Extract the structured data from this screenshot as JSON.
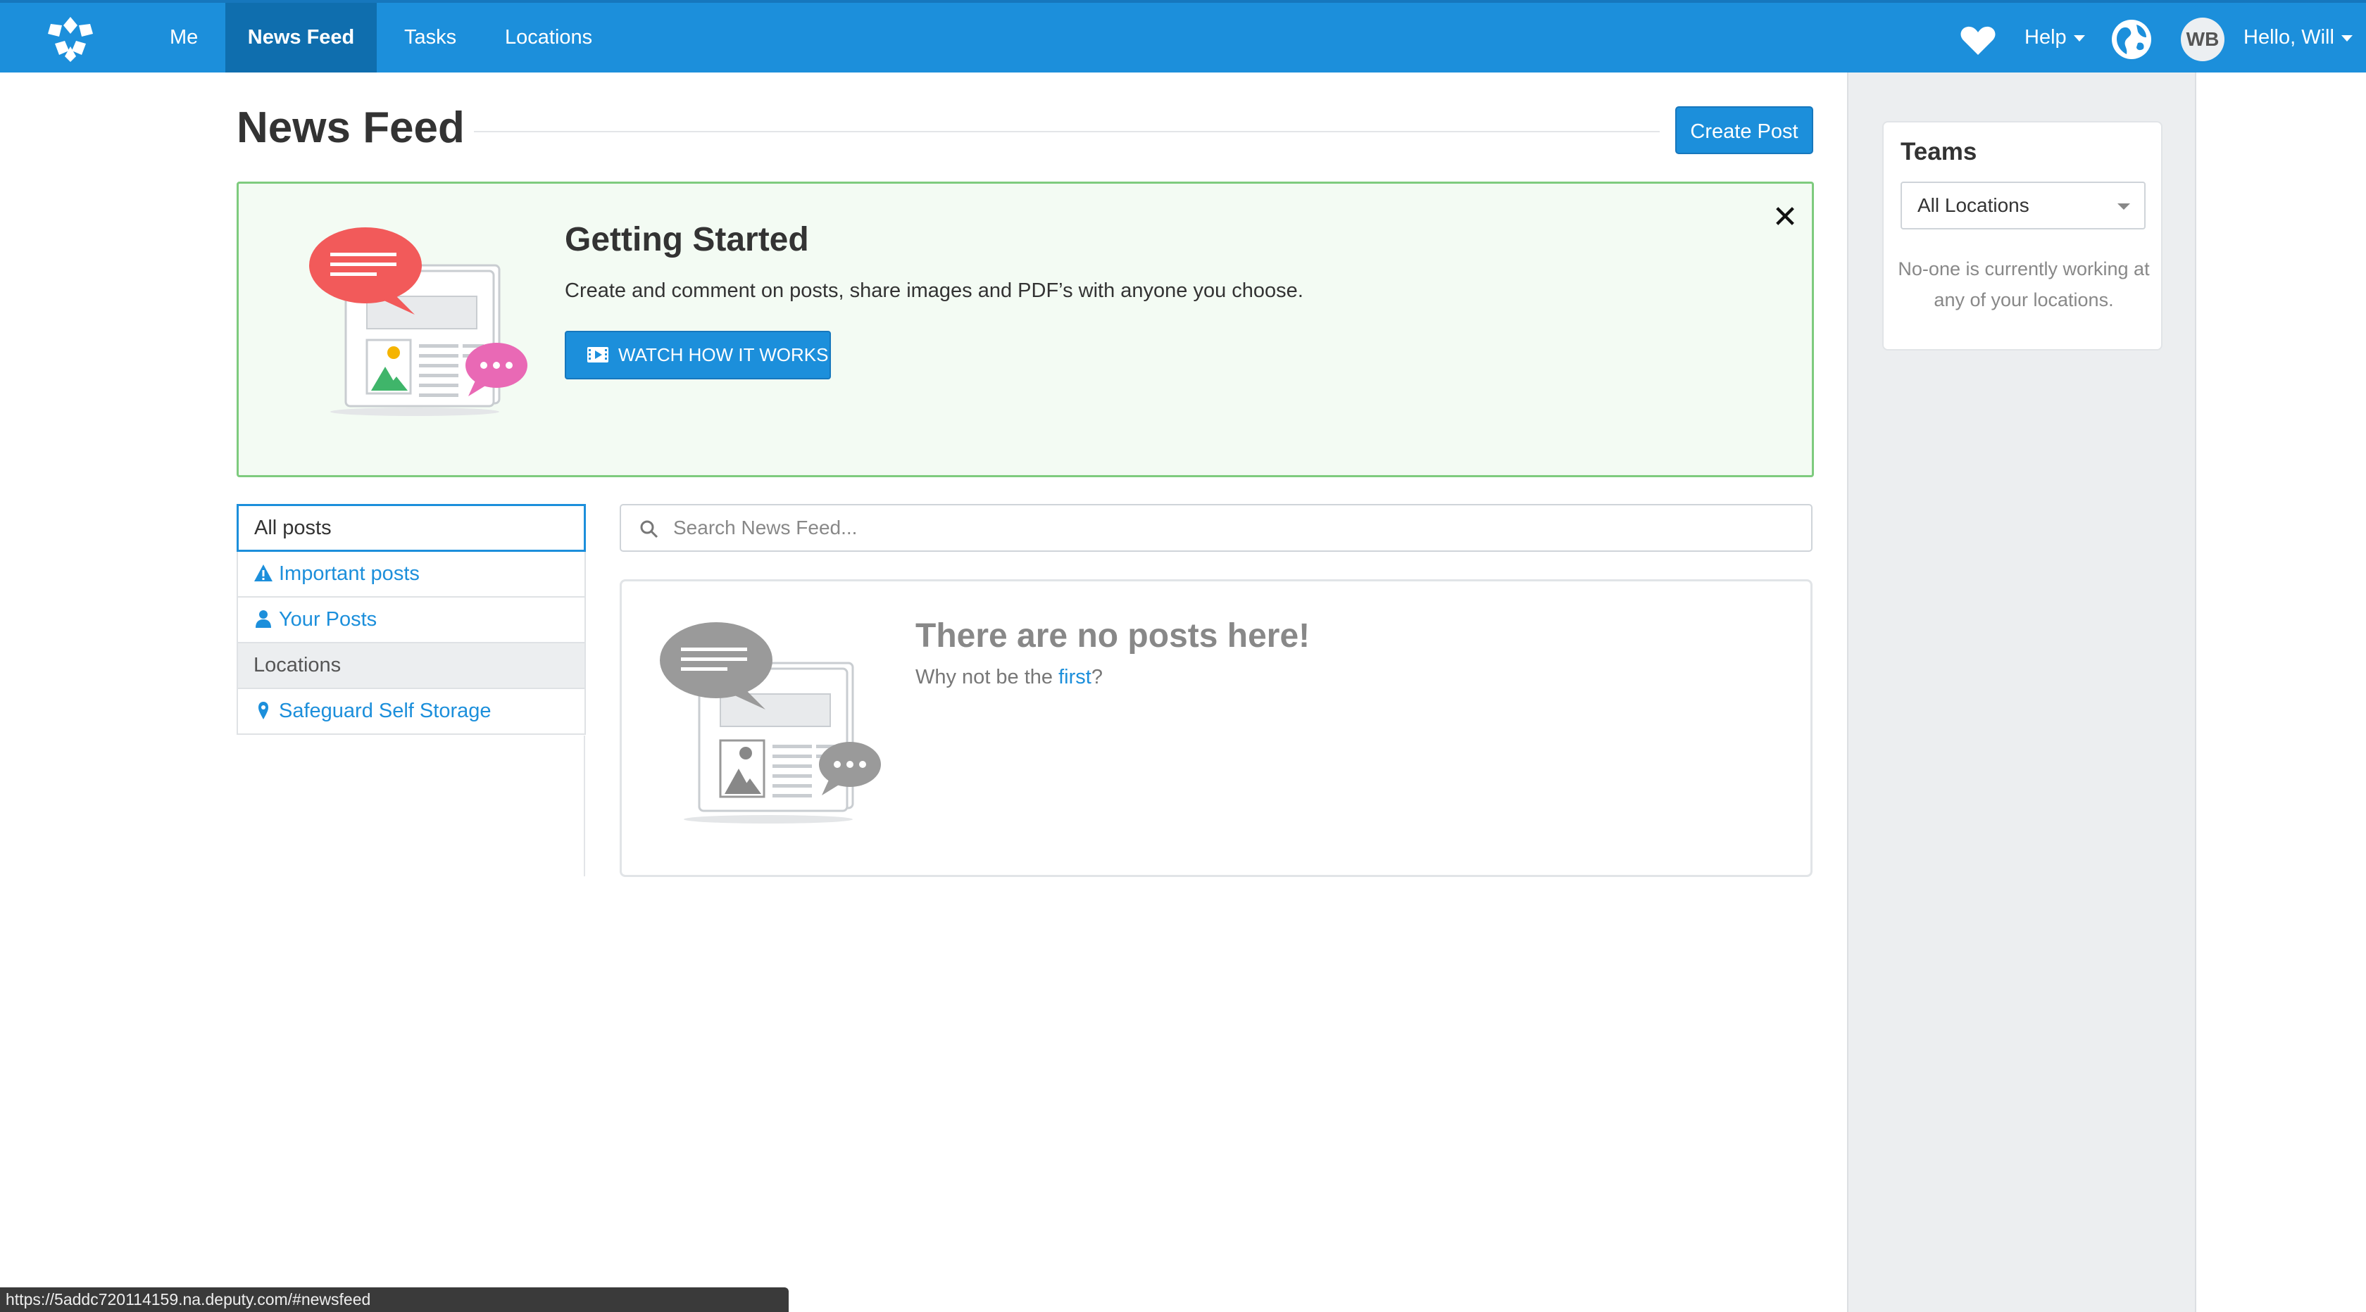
{
  "nav": {
    "items": [
      {
        "label": "Me",
        "active": false
      },
      {
        "label": "News Feed",
        "active": true
      },
      {
        "label": "Tasks",
        "active": false
      },
      {
        "label": "Locations",
        "active": false
      }
    ],
    "help_label": "Help",
    "avatar_initials": "WB",
    "greeting": "Hello, Will",
    "icons": [
      "logo-icon",
      "heart-icon",
      "globe-icon"
    ],
    "color": "#1c8fdb",
    "active_color": "#0f6eae"
  },
  "main": {
    "title": "News Feed",
    "create_post_label": "Create Post"
  },
  "banner": {
    "title": "Getting Started",
    "text": "Create and comment on posts, share images and PDF’s with anyone you choose.",
    "button_label": "WATCH HOW IT WORKS",
    "close_icon": "close-icon"
  },
  "filters": {
    "items": [
      {
        "label": "All posts",
        "icon": null,
        "type": "active"
      },
      {
        "label": "Important posts",
        "icon": "warning-icon",
        "type": "link"
      },
      {
        "label": "Your Posts",
        "icon": "user-icon",
        "type": "link"
      },
      {
        "label": "Locations",
        "icon": null,
        "type": "header"
      },
      {
        "label": "Safeguard Self Storage",
        "icon": "map-marker-icon",
        "type": "link"
      }
    ]
  },
  "search": {
    "placeholder": "Search News Feed...",
    "value": ""
  },
  "empty_state": {
    "title": "There are no posts here!",
    "subtitle_prefix": "Why not be the ",
    "subtitle_link": "first",
    "subtitle_suffix": "?"
  },
  "teams": {
    "title": "Teams",
    "selected_location": "All Locations",
    "note": "No-one is currently working at any of your locations."
  },
  "status_bar": {
    "url": "https://5addc720114159.na.deputy.com/#newsfeed"
  }
}
